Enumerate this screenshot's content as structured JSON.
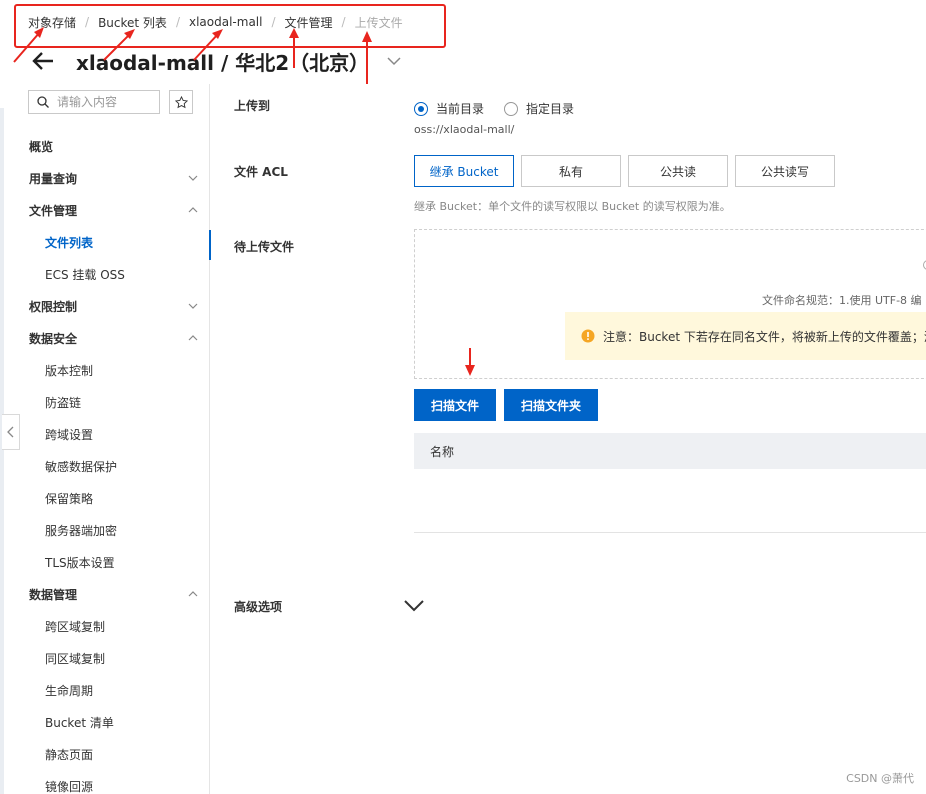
{
  "breadcrumb": {
    "items": [
      "对象存储",
      "Bucket 列表",
      "xlaodal-mall",
      "文件管理",
      "上传文件"
    ],
    "separator": "/"
  },
  "header": {
    "title": "xlaodal-mall / 华北2（北京）",
    "back_icon": "arrow-left-icon",
    "dropdown_icon": "chevron-down-icon"
  },
  "sidebar": {
    "search_placeholder": "请输入内容",
    "search_icon": "search-icon",
    "star_icon": "star-icon",
    "items": [
      {
        "label": "概览",
        "type": "group"
      },
      {
        "label": "用量查询",
        "type": "group",
        "chevron": "down"
      },
      {
        "label": "文件管理",
        "type": "group",
        "chevron": "up"
      },
      {
        "label": "文件列表",
        "type": "sub",
        "active": true
      },
      {
        "label": "ECS 挂载 OSS",
        "type": "sub"
      },
      {
        "label": "权限控制",
        "type": "group",
        "chevron": "down"
      },
      {
        "label": "数据安全",
        "type": "group",
        "chevron": "up"
      },
      {
        "label": "版本控制",
        "type": "sub"
      },
      {
        "label": "防盗链",
        "type": "sub"
      },
      {
        "label": "跨域设置",
        "type": "sub"
      },
      {
        "label": "敏感数据保护",
        "type": "sub"
      },
      {
        "label": "保留策略",
        "type": "sub"
      },
      {
        "label": "服务器端加密",
        "type": "sub"
      },
      {
        "label": "TLS版本设置",
        "type": "sub"
      },
      {
        "label": "数据管理",
        "type": "group",
        "chevron": "up"
      },
      {
        "label": "跨区域复制",
        "type": "sub"
      },
      {
        "label": "同区域复制",
        "type": "sub"
      },
      {
        "label": "生命周期",
        "type": "sub"
      },
      {
        "label": "Bucket 清单",
        "type": "sub"
      },
      {
        "label": "静态页面",
        "type": "sub"
      },
      {
        "label": "镜像回源",
        "type": "sub"
      }
    ]
  },
  "form": {
    "upload_to_label": "上传到",
    "radio_current": "当前目录",
    "radio_specified": "指定目录",
    "path": "oss://xlaodal-mall/",
    "acl_label": "文件 ACL",
    "acl_options": [
      "继承 Bucket",
      "私有",
      "公共读",
      "公共读写"
    ],
    "acl_hint": "继承 Bucket：单个文件的读写权限以 Bucket 的读写权限为准。",
    "pending_label": "待上传文件",
    "naming_rule": "文件命名规范：1.使用 UTF-8 编",
    "warning": "注意：Bucket 下若存在同名文件，将被新上传的文件覆盖；添",
    "scan_file": "扫描文件",
    "scan_folder": "扫描文件夹",
    "table_header_name": "名称",
    "advanced_label": "高级选项"
  },
  "watermark": "CSDN @萧代",
  "colors": {
    "accent": "#0064c8",
    "annotation_red": "#e8251e",
    "warning_bg": "#fff8dc",
    "warning_icon": "#f5a623"
  }
}
